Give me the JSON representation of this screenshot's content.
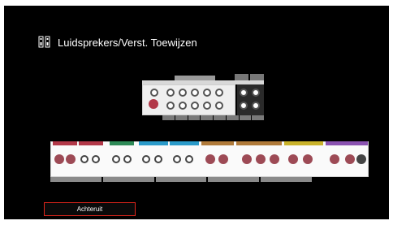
{
  "header": {
    "title": "Luidsprekers/Verst. Toewijzen",
    "icon": "speaker-config-icon"
  },
  "actions": {
    "back_label": "Achteruit"
  },
  "colors": {
    "background": "#000000",
    "accent_red": "#e0251b",
    "front": "#b23848",
    "center": "#2e8a57",
    "surround": "#2a9ac9",
    "surround_back": "#b07a3a",
    "height1": "#c9b22a",
    "height2": "#8a52b0"
  }
}
